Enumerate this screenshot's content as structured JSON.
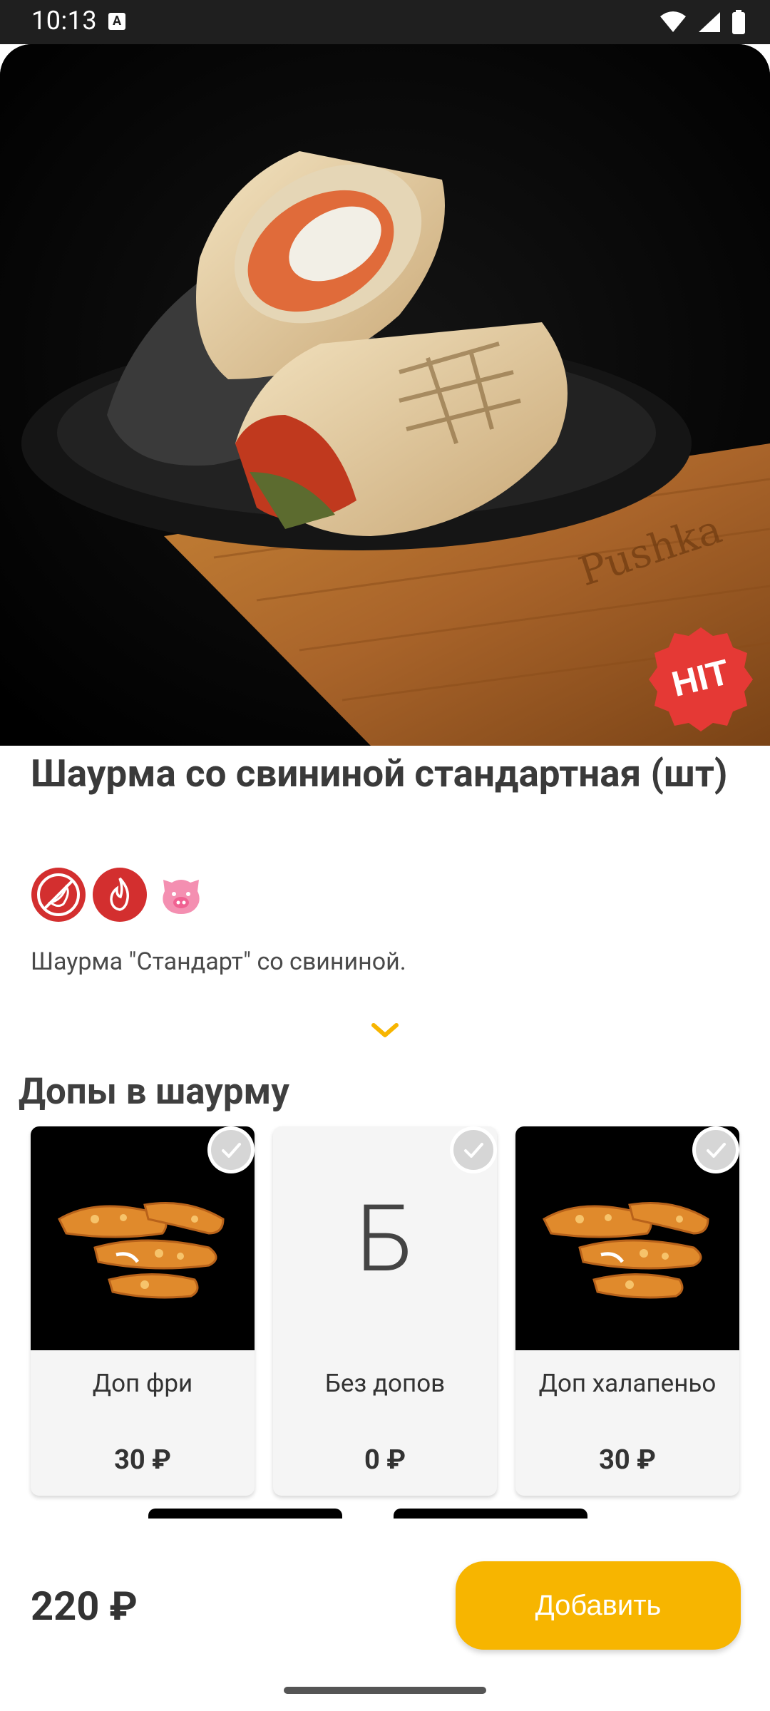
{
  "status_bar": {
    "time": "10:13",
    "notification_icon": "a-icon",
    "icons": [
      "wifi-icon",
      "signal-icon",
      "battery-icon"
    ]
  },
  "product": {
    "title": "Шаурма со свининой стандартная (шт)",
    "badge": "HIT",
    "attributes": [
      "not-spicy-icon",
      "hot-icon",
      "pork-icon"
    ],
    "description": "Шаурма \"Стандарт\" со свининой."
  },
  "addons": {
    "section_title": "Допы в шаурму",
    "items": [
      {
        "name": "Доп фри",
        "price": "30 ₽",
        "image": "fried-chicken-image"
      },
      {
        "name": "Без допов",
        "price": "0 ₽",
        "placeholder_letter": "Б"
      },
      {
        "name": "Доп халапеньо",
        "price": "30 ₽",
        "image": "fried-chicken-image"
      }
    ]
  },
  "footer": {
    "total": "220 ₽",
    "add_label": "Добавить"
  },
  "colors": {
    "accent": "#f7b500",
    "hit_badge": "#e53935",
    "badge_red": "#d32f2f",
    "pork": "#f48fb1"
  }
}
